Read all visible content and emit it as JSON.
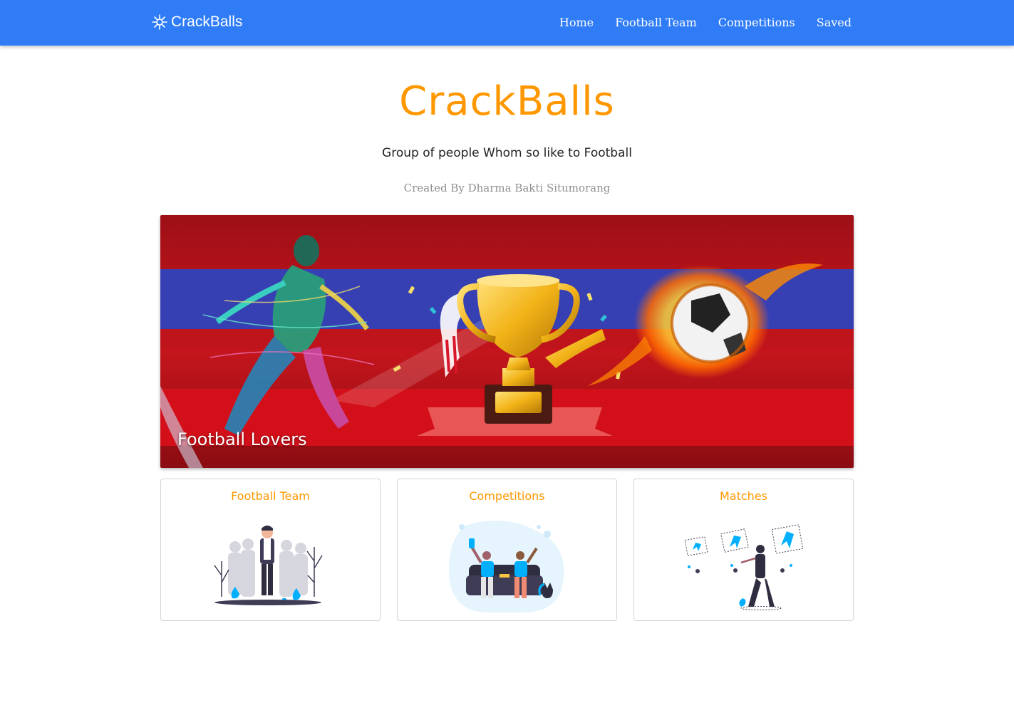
{
  "navbar": {
    "brand": "CrackBalls",
    "links": [
      "Home",
      "Football Team",
      "Competitions",
      "Saved"
    ]
  },
  "hero": {
    "title": "CrackBalls",
    "subtitle": "Group of people Whom so like to Football",
    "credit": "Created By Dharma Bakti Situmorang"
  },
  "banner": {
    "caption": "Football Lovers"
  },
  "cards": [
    {
      "title": "Football Team"
    },
    {
      "title": "Competitions"
    },
    {
      "title": "Matches"
    }
  ],
  "colors": {
    "navbar": "#2f7cf6",
    "accent": "#ff9800",
    "illustration": "#00b0ff"
  }
}
